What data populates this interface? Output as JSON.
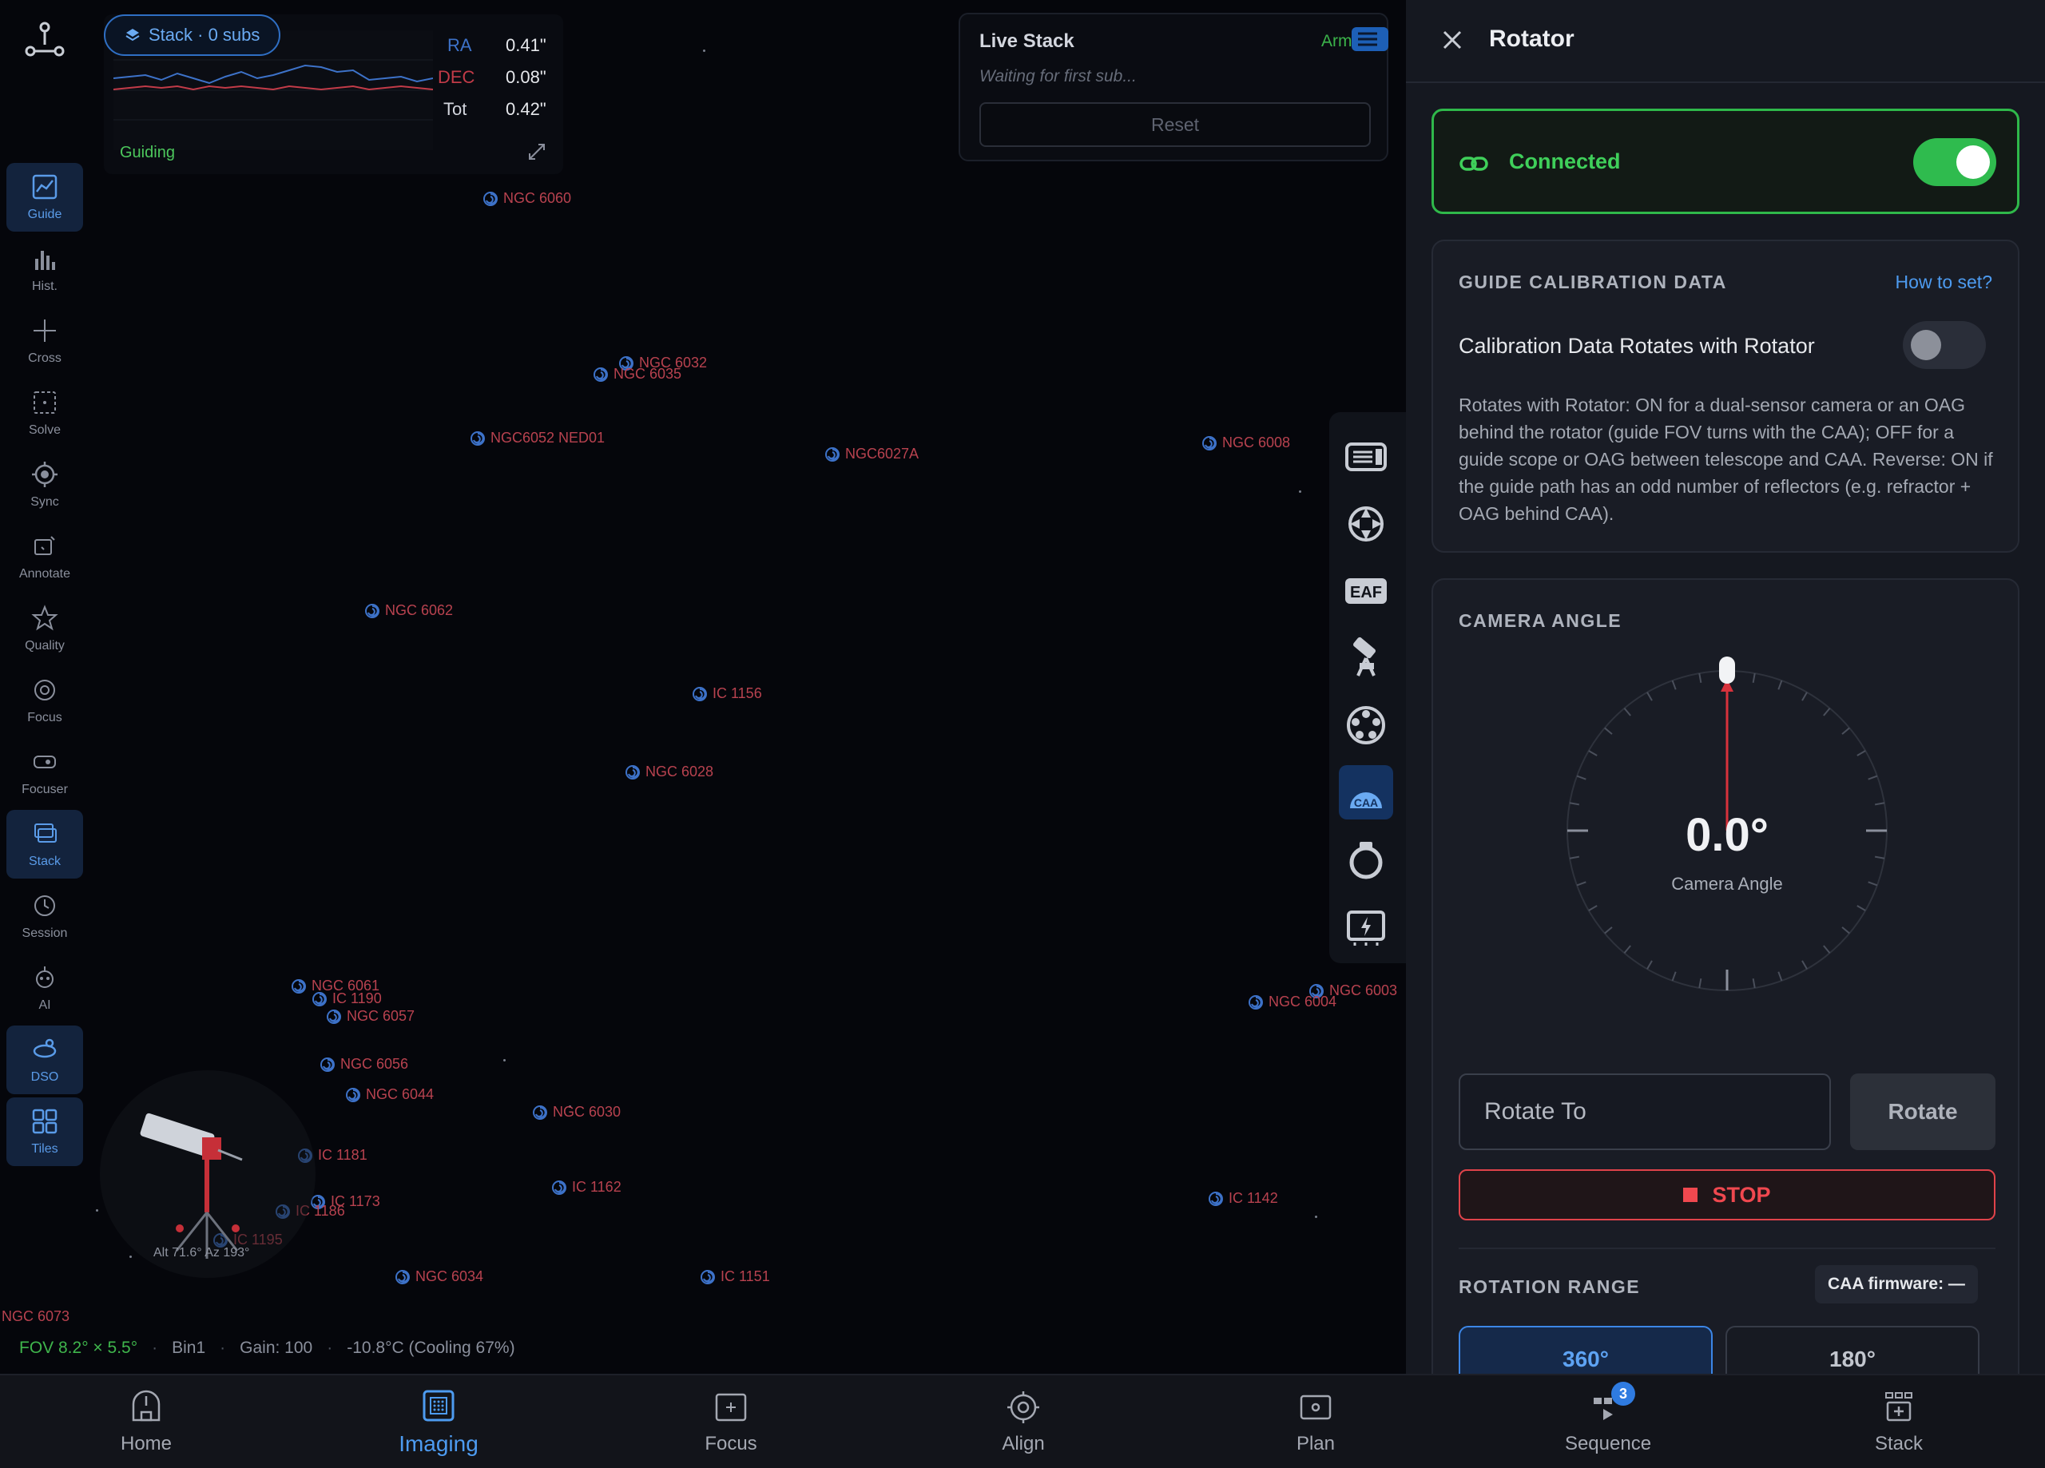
{
  "colors": {
    "accent": "#4d9bf0",
    "success": "#2fbb4e",
    "danger": "#f0484f",
    "dso_label": "#b8424f",
    "panel_bg": "#151820"
  },
  "rail": {
    "items": [
      {
        "label": "Guide",
        "icon": "chart-line-icon"
      },
      {
        "label": "Hist.",
        "icon": "histogram-icon"
      },
      {
        "label": "Cross",
        "icon": "crosshair-icon"
      },
      {
        "label": "Solve",
        "icon": "solve-frame-icon"
      },
      {
        "label": "Sync",
        "icon": "target-icon"
      },
      {
        "label": "Annotate",
        "icon": "annotate-icon"
      },
      {
        "label": "Quality",
        "icon": "star-icon"
      },
      {
        "label": "Focus",
        "icon": "focus-ring-icon"
      },
      {
        "label": "Focuser",
        "icon": "focuser-icon"
      },
      {
        "label": "Stack",
        "icon": "stack-icon"
      },
      {
        "label": "Session",
        "icon": "clock-icon"
      },
      {
        "label": "AI",
        "icon": "ai-icon"
      },
      {
        "label": "DSO",
        "icon": "galaxy-icon"
      },
      {
        "label": "Tiles",
        "icon": "tiles-icon"
      }
    ]
  },
  "guide": {
    "stack_pill": "Stack · 0 subs",
    "ra_label": "RA",
    "ra_value": "0.41\"",
    "dec_label": "DEC",
    "dec_value": "0.08\"",
    "tot_label": "Tot",
    "tot_value": "0.42\"",
    "label": "Guiding"
  },
  "live_stack": {
    "title": "Live Stack",
    "subtitle": "Waiting for first sub...",
    "armed": "Arm",
    "reset": "Reset"
  },
  "dso": [
    "NGC 6060",
    "NGC 6032",
    "NGC 6035",
    "NGC6052 NED01",
    "NGC6027A",
    "NGC 6008",
    "NGC 6062",
    "IC 1156",
    "NGC 6028",
    "NGC 6061",
    "IC 1190",
    "NGC 6057",
    "NGC 6003",
    "NGC 6004",
    "NGC 6056",
    "NGC 6044",
    "NGC 6030",
    "IC 1181",
    "IC 1162",
    "IC 1173",
    "IC 1186",
    "IC 1142",
    "IC 1195",
    "NGC 6034",
    "IC 1151",
    "NGC 6073"
  ],
  "mount": {
    "readout": "Alt 71.6° Az 193°"
  },
  "status": {
    "fov": "FOV 8.2° × 5.5°",
    "bin": "Bin1",
    "gain": "Gain: 100",
    "temp": "-10.8°C (Cooling 67%)"
  },
  "devices": [
    "camera-icon",
    "mount-icon",
    "eaf-icon",
    "telescope-icon",
    "filter-wheel-icon",
    "caa-icon",
    "ring-icon",
    "power-icon"
  ],
  "rotator": {
    "title": "Rotator",
    "connected_label": "Connected",
    "connected": true,
    "calib_header": "GUIDE CALIBRATION DATA",
    "calib_link": "How to set?",
    "calib_row": "Calibration Data Rotates with Rotator",
    "calib_on": false,
    "calib_desc": "Rotates with Rotator: ON for a dual-sensor camera or an OAG behind the rotator (guide FOV turns with the CAA); OFF for a guide scope or OAG between telescope and CAA. Reverse: ON if the guide path has an odd number of reflectors (e.g. refractor + OAG behind CAA).",
    "angle_header": "CAMERA ANGLE",
    "angle_value": "0.0°",
    "angle_deg": 0,
    "angle_sub": "Camera Angle",
    "rotate_placeholder": "Rotate To",
    "rotate_button": "Rotate",
    "stop_button": "STOP",
    "range_header": "ROTATION RANGE",
    "firmware": "CAA firmware: —",
    "range_360": "360°",
    "range_180": "180°"
  },
  "nav": {
    "items": [
      {
        "label": "Home",
        "icon": "home-icon"
      },
      {
        "label": "Imaging",
        "icon": "imaging-icon"
      },
      {
        "label": "Focus",
        "icon": "focus-frame-icon"
      },
      {
        "label": "Align",
        "icon": "align-icon"
      },
      {
        "label": "Plan",
        "icon": "plan-icon"
      },
      {
        "label": "Sequence",
        "icon": "sequence-icon",
        "badge": "3"
      },
      {
        "label": "Stack",
        "icon": "stack-add-icon"
      }
    ]
  }
}
